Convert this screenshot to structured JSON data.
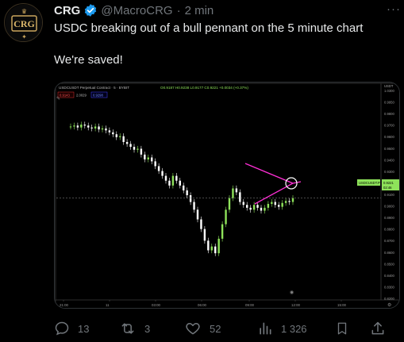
{
  "tweet": {
    "author_name": "CRG",
    "handle": "@MacroCRG",
    "separator": "·",
    "time": "2 min",
    "avatar_text": "CRG",
    "text": "USDC breaking out of a bull pennant on the 5 minute chart\n\nWe're saved!",
    "more": "···"
  },
  "chart": {
    "header_title": "USDCUSDT Perpetual Contract · 5 · BYBIT",
    "ohlc": "O0.9187 H0.9238 L0.9177 C0.9221 +0.0034 (+0.37%)",
    "price_boxes": [
      "0.9143",
      "2.0029",
      "0.9298"
    ],
    "currency": "USDT",
    "y_labels": [
      "1.0300",
      "0.9950",
      "0.9800",
      "0.9700",
      "0.9600",
      "0.9500",
      "0.9400",
      "0.9300",
      "0.9221",
      "0.9100",
      "0.9000",
      "0.8900",
      "0.8800",
      "0.8700",
      "0.8600",
      "0.8500",
      "0.8400",
      "0.8300",
      "0.8200"
    ],
    "x_labels": [
      "21:00",
      "11",
      "03:00",
      "06:00",
      "09:00",
      "12:00",
      "15:00"
    ],
    "current_label": "USDCUSDT.P",
    "current_price": "0.9221",
    "current_sub": "02:46",
    "colors": {
      "up": "#8ee35a",
      "down": "#ffffff",
      "pennant": "#ff2fd6",
      "grid": "#1b1b1b"
    }
  },
  "chart_data": {
    "type": "candlestick",
    "title": "USDCUSDT Perpetual Contract · 5 · BYBIT",
    "xlabel": "",
    "ylabel": "USDT",
    "ylim": [
      0.82,
      1.03
    ],
    "x_ticks": [
      "21:00",
      "11",
      "03:00",
      "06:00",
      "09:00",
      "12:00",
      "15:00"
    ],
    "series": [
      {
        "values": [
          0.996,
          0.997,
          0.995,
          0.998,
          0.997,
          0.995,
          0.994,
          0.996,
          0.993,
          0.994,
          0.992,
          0.99,
          0.988,
          0.985,
          0.986,
          0.98,
          0.978,
          0.975,
          0.972,
          0.973,
          0.967,
          0.962,
          0.964,
          0.96,
          0.955,
          0.95,
          0.945,
          0.94,
          0.935,
          0.945,
          0.94,
          0.935,
          0.93,
          0.925,
          0.918,
          0.91,
          0.9,
          0.89,
          0.878,
          0.868,
          0.872,
          0.865,
          0.88,
          0.895,
          0.91,
          0.922,
          0.932,
          0.928,
          0.918,
          0.915,
          0.912,
          0.91,
          0.915,
          0.912,
          0.909,
          0.912,
          0.916,
          0.918,
          0.915,
          0.913,
          0.917,
          0.919,
          0.918,
          0.922
        ]
      }
    ],
    "annotations": [
      "bull pennant",
      "breakout circle"
    ]
  },
  "actions": {
    "replies": "13",
    "retweets": "3",
    "likes": "52",
    "views": "1 326"
  }
}
